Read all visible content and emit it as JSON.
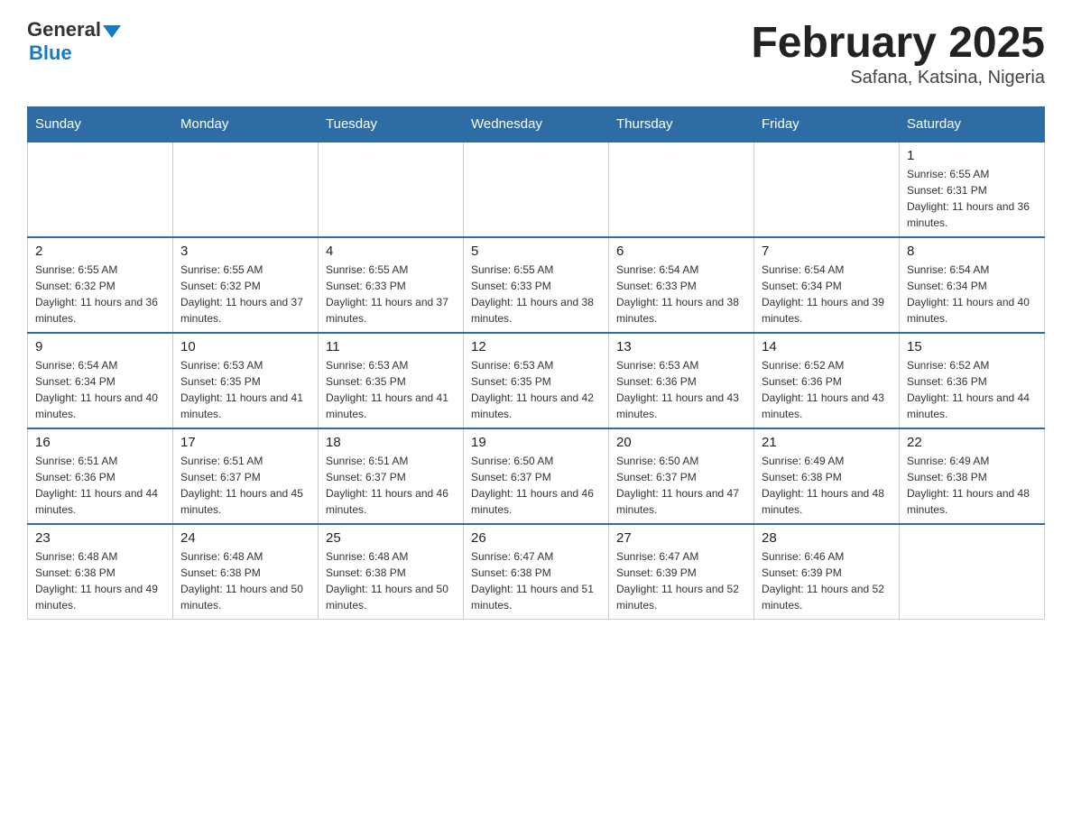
{
  "header": {
    "logo_general": "General",
    "logo_blue": "Blue",
    "title": "February 2025",
    "subtitle": "Safana, Katsina, Nigeria"
  },
  "days_of_week": [
    "Sunday",
    "Monday",
    "Tuesday",
    "Wednesday",
    "Thursday",
    "Friday",
    "Saturday"
  ],
  "weeks": [
    {
      "days": [
        {
          "num": "",
          "info": ""
        },
        {
          "num": "",
          "info": ""
        },
        {
          "num": "",
          "info": ""
        },
        {
          "num": "",
          "info": ""
        },
        {
          "num": "",
          "info": ""
        },
        {
          "num": "",
          "info": ""
        },
        {
          "num": "1",
          "info": "Sunrise: 6:55 AM\nSunset: 6:31 PM\nDaylight: 11 hours and 36 minutes."
        }
      ]
    },
    {
      "days": [
        {
          "num": "2",
          "info": "Sunrise: 6:55 AM\nSunset: 6:32 PM\nDaylight: 11 hours and 36 minutes."
        },
        {
          "num": "3",
          "info": "Sunrise: 6:55 AM\nSunset: 6:32 PM\nDaylight: 11 hours and 37 minutes."
        },
        {
          "num": "4",
          "info": "Sunrise: 6:55 AM\nSunset: 6:33 PM\nDaylight: 11 hours and 37 minutes."
        },
        {
          "num": "5",
          "info": "Sunrise: 6:55 AM\nSunset: 6:33 PM\nDaylight: 11 hours and 38 minutes."
        },
        {
          "num": "6",
          "info": "Sunrise: 6:54 AM\nSunset: 6:33 PM\nDaylight: 11 hours and 38 minutes."
        },
        {
          "num": "7",
          "info": "Sunrise: 6:54 AM\nSunset: 6:34 PM\nDaylight: 11 hours and 39 minutes."
        },
        {
          "num": "8",
          "info": "Sunrise: 6:54 AM\nSunset: 6:34 PM\nDaylight: 11 hours and 40 minutes."
        }
      ]
    },
    {
      "days": [
        {
          "num": "9",
          "info": "Sunrise: 6:54 AM\nSunset: 6:34 PM\nDaylight: 11 hours and 40 minutes."
        },
        {
          "num": "10",
          "info": "Sunrise: 6:53 AM\nSunset: 6:35 PM\nDaylight: 11 hours and 41 minutes."
        },
        {
          "num": "11",
          "info": "Sunrise: 6:53 AM\nSunset: 6:35 PM\nDaylight: 11 hours and 41 minutes."
        },
        {
          "num": "12",
          "info": "Sunrise: 6:53 AM\nSunset: 6:35 PM\nDaylight: 11 hours and 42 minutes."
        },
        {
          "num": "13",
          "info": "Sunrise: 6:53 AM\nSunset: 6:36 PM\nDaylight: 11 hours and 43 minutes."
        },
        {
          "num": "14",
          "info": "Sunrise: 6:52 AM\nSunset: 6:36 PM\nDaylight: 11 hours and 43 minutes."
        },
        {
          "num": "15",
          "info": "Sunrise: 6:52 AM\nSunset: 6:36 PM\nDaylight: 11 hours and 44 minutes."
        }
      ]
    },
    {
      "days": [
        {
          "num": "16",
          "info": "Sunrise: 6:51 AM\nSunset: 6:36 PM\nDaylight: 11 hours and 44 minutes."
        },
        {
          "num": "17",
          "info": "Sunrise: 6:51 AM\nSunset: 6:37 PM\nDaylight: 11 hours and 45 minutes."
        },
        {
          "num": "18",
          "info": "Sunrise: 6:51 AM\nSunset: 6:37 PM\nDaylight: 11 hours and 46 minutes."
        },
        {
          "num": "19",
          "info": "Sunrise: 6:50 AM\nSunset: 6:37 PM\nDaylight: 11 hours and 46 minutes."
        },
        {
          "num": "20",
          "info": "Sunrise: 6:50 AM\nSunset: 6:37 PM\nDaylight: 11 hours and 47 minutes."
        },
        {
          "num": "21",
          "info": "Sunrise: 6:49 AM\nSunset: 6:38 PM\nDaylight: 11 hours and 48 minutes."
        },
        {
          "num": "22",
          "info": "Sunrise: 6:49 AM\nSunset: 6:38 PM\nDaylight: 11 hours and 48 minutes."
        }
      ]
    },
    {
      "days": [
        {
          "num": "23",
          "info": "Sunrise: 6:48 AM\nSunset: 6:38 PM\nDaylight: 11 hours and 49 minutes."
        },
        {
          "num": "24",
          "info": "Sunrise: 6:48 AM\nSunset: 6:38 PM\nDaylight: 11 hours and 50 minutes."
        },
        {
          "num": "25",
          "info": "Sunrise: 6:48 AM\nSunset: 6:38 PM\nDaylight: 11 hours and 50 minutes."
        },
        {
          "num": "26",
          "info": "Sunrise: 6:47 AM\nSunset: 6:38 PM\nDaylight: 11 hours and 51 minutes."
        },
        {
          "num": "27",
          "info": "Sunrise: 6:47 AM\nSunset: 6:39 PM\nDaylight: 11 hours and 52 minutes."
        },
        {
          "num": "28",
          "info": "Sunrise: 6:46 AM\nSunset: 6:39 PM\nDaylight: 11 hours and 52 minutes."
        },
        {
          "num": "",
          "info": ""
        }
      ]
    }
  ]
}
